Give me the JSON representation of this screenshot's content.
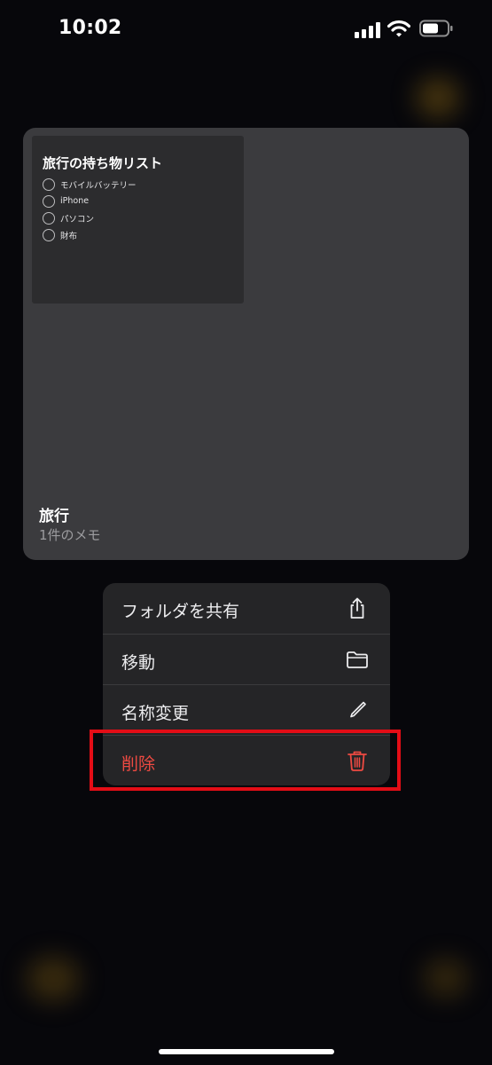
{
  "status_bar": {
    "time": "10:02",
    "icons": [
      "signal-icon",
      "wifi-icon",
      "battery-icon"
    ]
  },
  "folder_card": {
    "note_preview": {
      "title": "旅行の持ち物リスト",
      "items": [
        "モバイルバッテリー",
        "iPhone",
        "パソコン",
        "財布"
      ]
    },
    "name": "旅行",
    "count": "1件のメモ"
  },
  "context_menu": {
    "items": [
      {
        "label": "フォルダを共有",
        "icon": "share-icon"
      },
      {
        "label": "移動",
        "icon": "folder-icon"
      },
      {
        "label": "名称変更",
        "icon": "pencil-icon"
      },
      {
        "label": "削除",
        "icon": "trash-icon",
        "destructive": true
      }
    ]
  },
  "colors": {
    "background": "#07070b",
    "card": "#3b3b3e",
    "menu": "#252527",
    "destructive": "#ee4a42",
    "highlight_box": "#e30d16"
  }
}
